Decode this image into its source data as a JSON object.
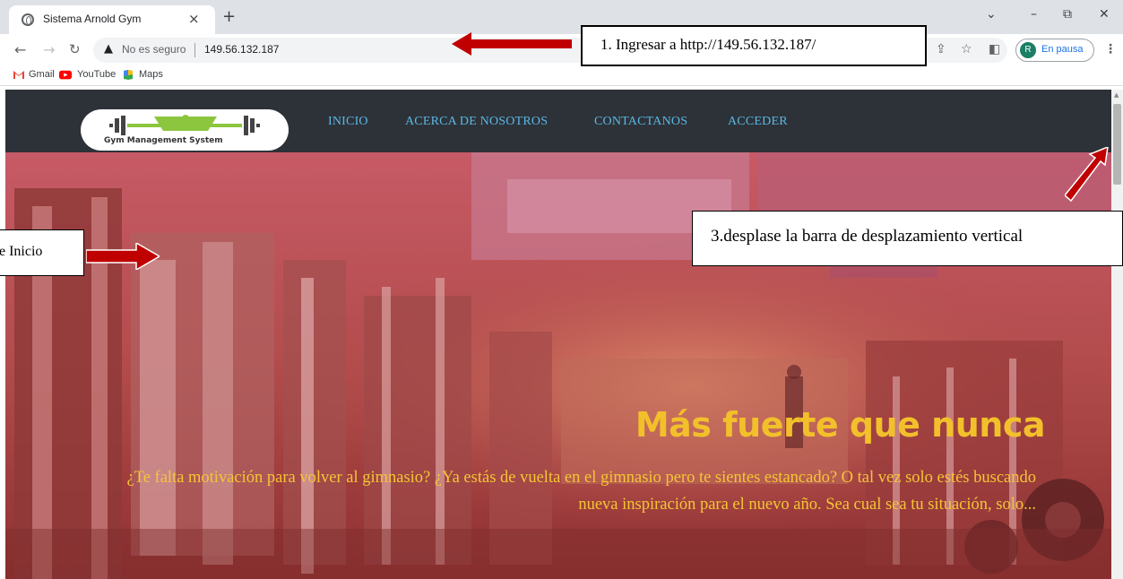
{
  "browser": {
    "tab_title": "Sistema Arnold Gym",
    "tab_close": "×",
    "new_tab": "+",
    "window_controls": {
      "minimize": "–",
      "restore": "⧉",
      "close": "✕",
      "menu": "⌄"
    },
    "not_secure": "No es seguro",
    "url": "149.56.132.187",
    "profile_initial": "R",
    "profile_status": "En pausa",
    "bookmarks": [
      "Gmail",
      "YouTube",
      "Maps"
    ]
  },
  "site": {
    "logo_sub": "Gym Management System",
    "nav": [
      "INICIO",
      "ACERCA DE NOSOTROS",
      "CONTACTANOS",
      "ACCEDER"
    ],
    "hero_title": "Más fuerte que nunca",
    "hero_text": "¿Te falta motivación para volver al gimnasio? ¿Ya estás de vuelta en el gimnasio pero te sientes estancado? O tal vez solo estés buscando nueva inspiración para el nuevo año. Sea cual sea tu situación, solo..."
  },
  "annotations": {
    "step1": "1. Ingresar a http://149.56.132.187/",
    "step2": "e Inicio",
    "step3": "3.desplase la barra de desplazamiento vertical"
  },
  "colors": {
    "nav_bg": "#2d3238",
    "nav_link": "#5bb8e6",
    "hero_overlay": "#b84a4a",
    "hero_title": "#f2c02a",
    "arrow_red": "#c00000"
  }
}
